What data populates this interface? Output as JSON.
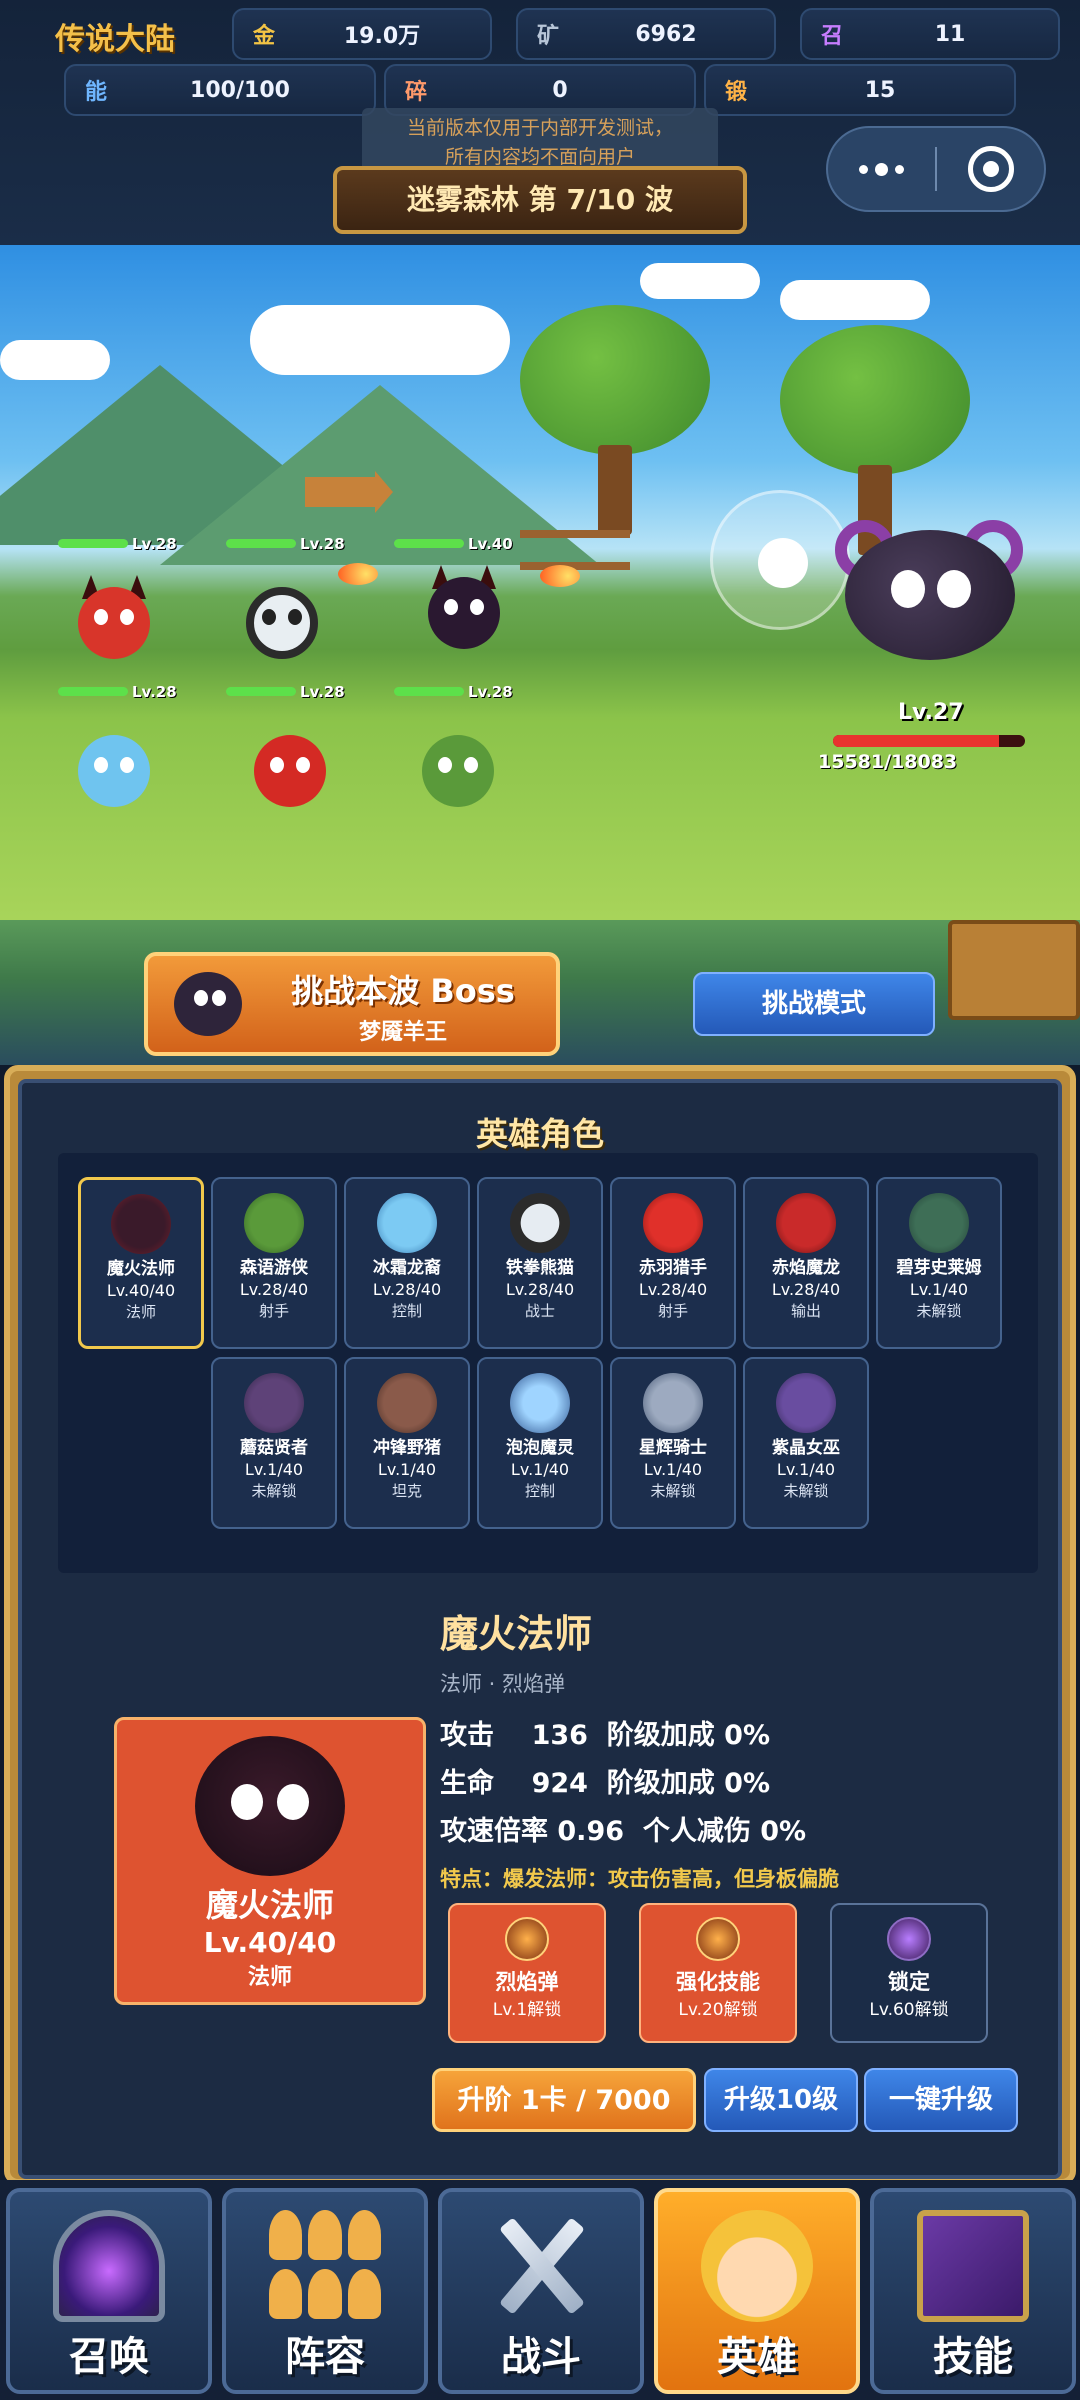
{
  "game_title": "传说大陆",
  "stats": [
    {
      "key": "金",
      "value": "19.0万"
    },
    {
      "key": "矿",
      "value": "6962"
    },
    {
      "key": "召",
      "value": "11"
    },
    {
      "key": "能",
      "value": "100/100"
    },
    {
      "key": "碎",
      "value": "0"
    },
    {
      "key": "锻",
      "value": "15"
    }
  ],
  "notice": {
    "line1": "当前版本仅用于内部开发测试，",
    "line2": "所有内容均不面向用户"
  },
  "wave_banner": "迷雾森林 第 7/10 波",
  "battle": {
    "team_levels": [
      "Lv.28",
      "Lv.28",
      "Lv.40",
      "Lv.28",
      "Lv.28",
      "Lv.28"
    ],
    "boss_level": "Lv.27",
    "boss_hp_text": "15581/18083",
    "boss_hp_fraction": 0.862
  },
  "challenge": {
    "title": "挑战本波 Boss",
    "subtitle": "梦魇羊王",
    "mode_button": "挑战模式"
  },
  "hero_panel": {
    "title": "英雄角色",
    "heroes": [
      {
        "name": "魔火法师",
        "level": "Lv.40/40",
        "role": "法师",
        "selected": true
      },
      {
        "name": "森语游侠",
        "level": "Lv.28/40",
        "role": "射手"
      },
      {
        "name": "冰霜龙裔",
        "level": "Lv.28/40",
        "role": "控制"
      },
      {
        "name": "铁拳熊猫",
        "level": "Lv.28/40",
        "role": "战士"
      },
      {
        "name": "赤羽猎手",
        "level": "Lv.28/40",
        "role": "射手"
      },
      {
        "name": "赤焰魔龙",
        "level": "Lv.28/40",
        "role": "输出"
      },
      {
        "name": "碧芽史莱姆",
        "level": "Lv.1/40",
        "role": "未解锁"
      },
      {
        "name": "蘑菇贤者",
        "level": "Lv.1/40",
        "role": "未解锁"
      },
      {
        "name": "冲锋野猪",
        "level": "Lv.1/40",
        "role": "坦克"
      },
      {
        "name": "泡泡魔灵",
        "level": "Lv.1/40",
        "role": "控制"
      },
      {
        "name": "星辉骑士",
        "level": "Lv.1/40",
        "role": "未解锁"
      },
      {
        "name": "紫晶女巫",
        "level": "Lv.1/40",
        "role": "未解锁"
      }
    ],
    "detail": {
      "name": "魔火法师",
      "subtitle": "法师 · 烈焰弹",
      "portrait_level": "Lv.40/40",
      "portrait_role": "法师",
      "line1": "攻击    136  阶级加成 0%",
      "line2": "生命    924  阶级加成 0%",
      "line3": "攻速倍率 0.96  个人减伤 0%",
      "trait": "特点：爆发法师：攻击伤害高，但身板偏脆",
      "skills": [
        {
          "name": "烈焰弹",
          "unlock": "Lv.1解锁"
        },
        {
          "name": "强化技能",
          "unlock": "Lv.20解锁"
        },
        {
          "name": "锁定",
          "unlock": "Lv.60解锁"
        }
      ]
    },
    "actions": {
      "advance": "升阶 1卡 / 7000",
      "upgrade10": "升级10级",
      "upgrade_all": "一键升级"
    }
  },
  "nav": [
    {
      "label": "召唤",
      "icon": "portal-icon"
    },
    {
      "label": "阵容",
      "icon": "team-icon"
    },
    {
      "label": "战斗",
      "icon": "crossed-swords-icon"
    },
    {
      "label": "英雄",
      "icon": "hero-portrait-icon",
      "active": true
    },
    {
      "label": "技能",
      "icon": "spellbook-icon"
    }
  ]
}
